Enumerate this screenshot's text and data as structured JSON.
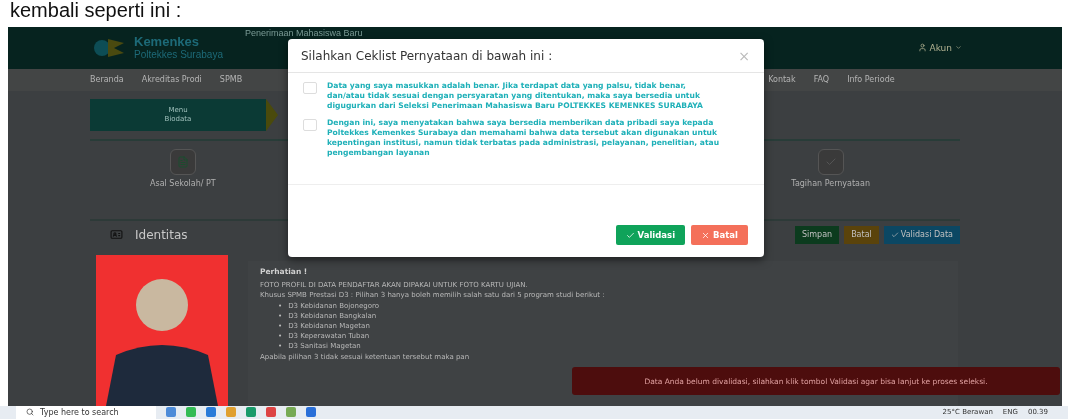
{
  "caption": "kembali seperti ini :",
  "header": {
    "brand": "Kemenkes",
    "subtitle": "Poltekkes Surabaya",
    "title": "Penerimaan Mahasiswa Baru",
    "account": "Akun"
  },
  "nav": [
    "Beranda",
    "Akreditas Prodi",
    "SPMB",
    "Kontak",
    "FAQ",
    "Info Periode"
  ],
  "menu": {
    "line_1": "Menu",
    "line_2": "Biodata"
  },
  "steps": [
    "Asal Sekolah/ PT",
    "Tagihan Pernyataan"
  ],
  "section": {
    "title": "Identitas",
    "buttons": [
      {
        "label": "Simpan",
        "kind": "save"
      },
      {
        "label": "Batal",
        "kind": "reset"
      },
      {
        "label": "Validasi Data",
        "kind": "validate"
      }
    ]
  },
  "notice": {
    "heading": "Perhatian !",
    "lines": [
      "FOTO PROFIL DI DATA PENDAFTAR AKAN DIPAKAI UNTUK FOTO KARTU UJIAN.",
      "Khusus SPMB Prestasi D3 : Pilihan 3 hanya boleh memilih salah satu dari 5 program studi berikut :"
    ],
    "bullet": "•",
    "programs": [
      "D3 Kebidanan Bojonegoro",
      "D3 Kebidanan Bangkalan",
      "D3 Kebidanan Magetan",
      "D3 Keperawatan Tuban",
      "D3 Sanitasi Magetan"
    ],
    "footer": "Apabila pilihan 3 tidak sesuai ketentuan tersebut maka pan"
  },
  "toast": "Data Anda belum divalidasi, silahkan klik tombol Validasi agar bisa lanjut ke proses seleksi.",
  "modal": {
    "title": "Silahkan Ceklist Pernyataan di bawah ini :",
    "close": "×",
    "statements": [
      {
        "text": "Data yang saya masukkan adalah benar. Jika terdapat data yang palsu, tidak benar, dan/atau tidak sesuai dengan persyaratan yang ditentukan, maka saya bersedia untuk digugurkan dari Seleksi Penerimaan Mahasiswa Baru POLTEKKES KEMENKES SURABAYA",
        "checked": false
      },
      {
        "text": "Dengan ini, saya menyatakan bahwa saya bersedia memberikan data pribadi saya kepada Poltekkes Kemenkes Surabaya dan memahami bahwa data tersebut akan digunakan untuk kepentingan institusi, namun tidak terbatas pada administrasi, pelayanan, penelitian, atau pengembangan layanan",
        "checked": false
      }
    ],
    "confirm": "Validasi",
    "cancel": "Batal"
  },
  "taskbar": {
    "search": "Type here to search",
    "weather": "25°C Berawan",
    "language": "ENG",
    "time": "00.39"
  }
}
